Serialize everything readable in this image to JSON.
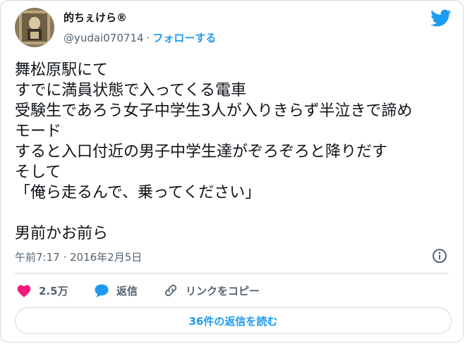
{
  "author": {
    "name": "的ちぇけら®",
    "handle": "@yudai070714",
    "separator": "·",
    "follow_label": "フォローする",
    "avatar_icon": "avatar-photo"
  },
  "brand_icon": "twitter-bird-icon",
  "tweet": {
    "lines": [
      "舞松原駅にて",
      "すでに満員状態で入ってくる電車",
      "受験生であろう女子中学生3人が入りきらず半泣きで諦め",
      "モード",
      "すると入口付近の男子中学生達がぞろぞろと降りだす",
      "そして",
      "「俺ら走るんで、乗ってください」",
      "",
      "男前かお前ら"
    ]
  },
  "timestamp": "午前7:17 · 2016年2月5日",
  "actions": {
    "like_count": "2.5万",
    "reply_label": "返信",
    "copy_link_label": "リンクをコピー"
  },
  "replies_button_label": "36件の返信を読む",
  "colors": {
    "accent": "#1d9bf0",
    "like": "#f91880",
    "text": "#0f1419",
    "secondary": "#536471",
    "border": "#cfd9de"
  }
}
